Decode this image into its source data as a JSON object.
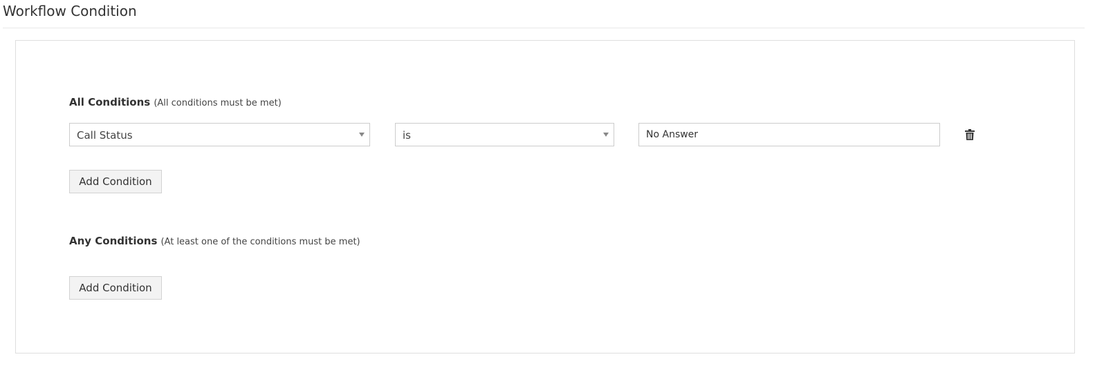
{
  "page": {
    "title": "Workflow Condition"
  },
  "all_conditions": {
    "label": "All Conditions",
    "hint": "(All conditions must be met)",
    "rows": [
      {
        "field": "Call Status",
        "operator": "is",
        "value": "No Answer",
        "delete_icon": "trash-icon"
      }
    ],
    "add_label": "Add Condition"
  },
  "any_conditions": {
    "label": "Any Conditions",
    "hint": "(At least one of the conditions must be met)",
    "rows": [],
    "add_label": "Add Condition"
  },
  "colors": {
    "border": "#cccccc",
    "button_bg": "#f3f3f3",
    "text": "#333333"
  }
}
